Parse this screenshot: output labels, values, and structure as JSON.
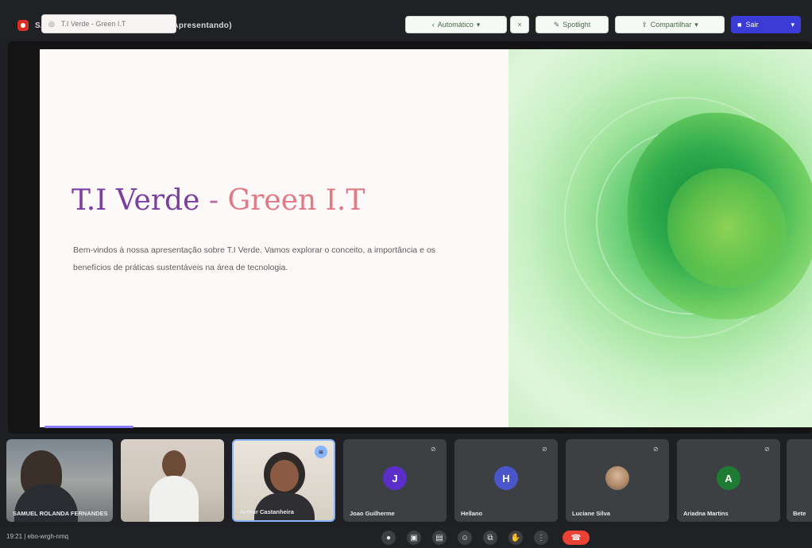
{
  "window": {
    "presenter_name": "SAMUEL ROLANDA FERNANDES (Apresentando)"
  },
  "slide_toolbar": {
    "tab_title": "T.I Verde - Green I.T",
    "autoplay_label": "Automático",
    "spotlight_label": "Spotlight",
    "share_label": "Compartilhar",
    "present_label": "Sair"
  },
  "slide": {
    "title_part1": "T.I Verde",
    "title_sep": " - ",
    "title_part2": "Green I.T",
    "body": "Bem-vindos à nossa apresentação sobre T.I Verde. Vamos explorar o conceito, a importância e os benefícios de práticas sustentáveis na área de tecnologia.",
    "progress": 0.19
  },
  "participants": [
    {
      "name": "SAMUEL ROLANDA FERNANDES",
      "type": "video"
    },
    {
      "name": "",
      "type": "video"
    },
    {
      "name": "Arthur Castanheira",
      "type": "video"
    },
    {
      "name": "Joao Guilherme",
      "type": "avatar",
      "initial": "J",
      "color": "#5b2ec9"
    },
    {
      "name": "Hellano",
      "type": "avatar",
      "initial": "H",
      "color": "#4a55c9"
    },
    {
      "name": "Luciane Silva",
      "type": "photo",
      "initial": "",
      "color": "#6b5a4a"
    },
    {
      "name": "Ariadna Martins",
      "type": "avatar",
      "initial": "A",
      "color": "#1e7b34"
    },
    {
      "name": "Bete",
      "type": "partial"
    }
  ],
  "bottom_bar": {
    "time_and_code": "19:21  |  ebo-wrgh-nmq"
  },
  "colors": {
    "accent_purple": "#3b3bd6",
    "end_call_red": "#ea4335",
    "title_purple": "#7b3fa0",
    "title_pink": "#e07a86"
  },
  "icons": [
    "record-icon",
    "globe-icon",
    "spotlight-icon",
    "share-icon",
    "stop-icon",
    "chevron-down-icon",
    "mic-off-icon",
    "mic-icon",
    "camera-icon",
    "captions-icon",
    "emoji-icon",
    "present-icon",
    "raise-hand-icon",
    "more-icon",
    "end-call-icon"
  ]
}
